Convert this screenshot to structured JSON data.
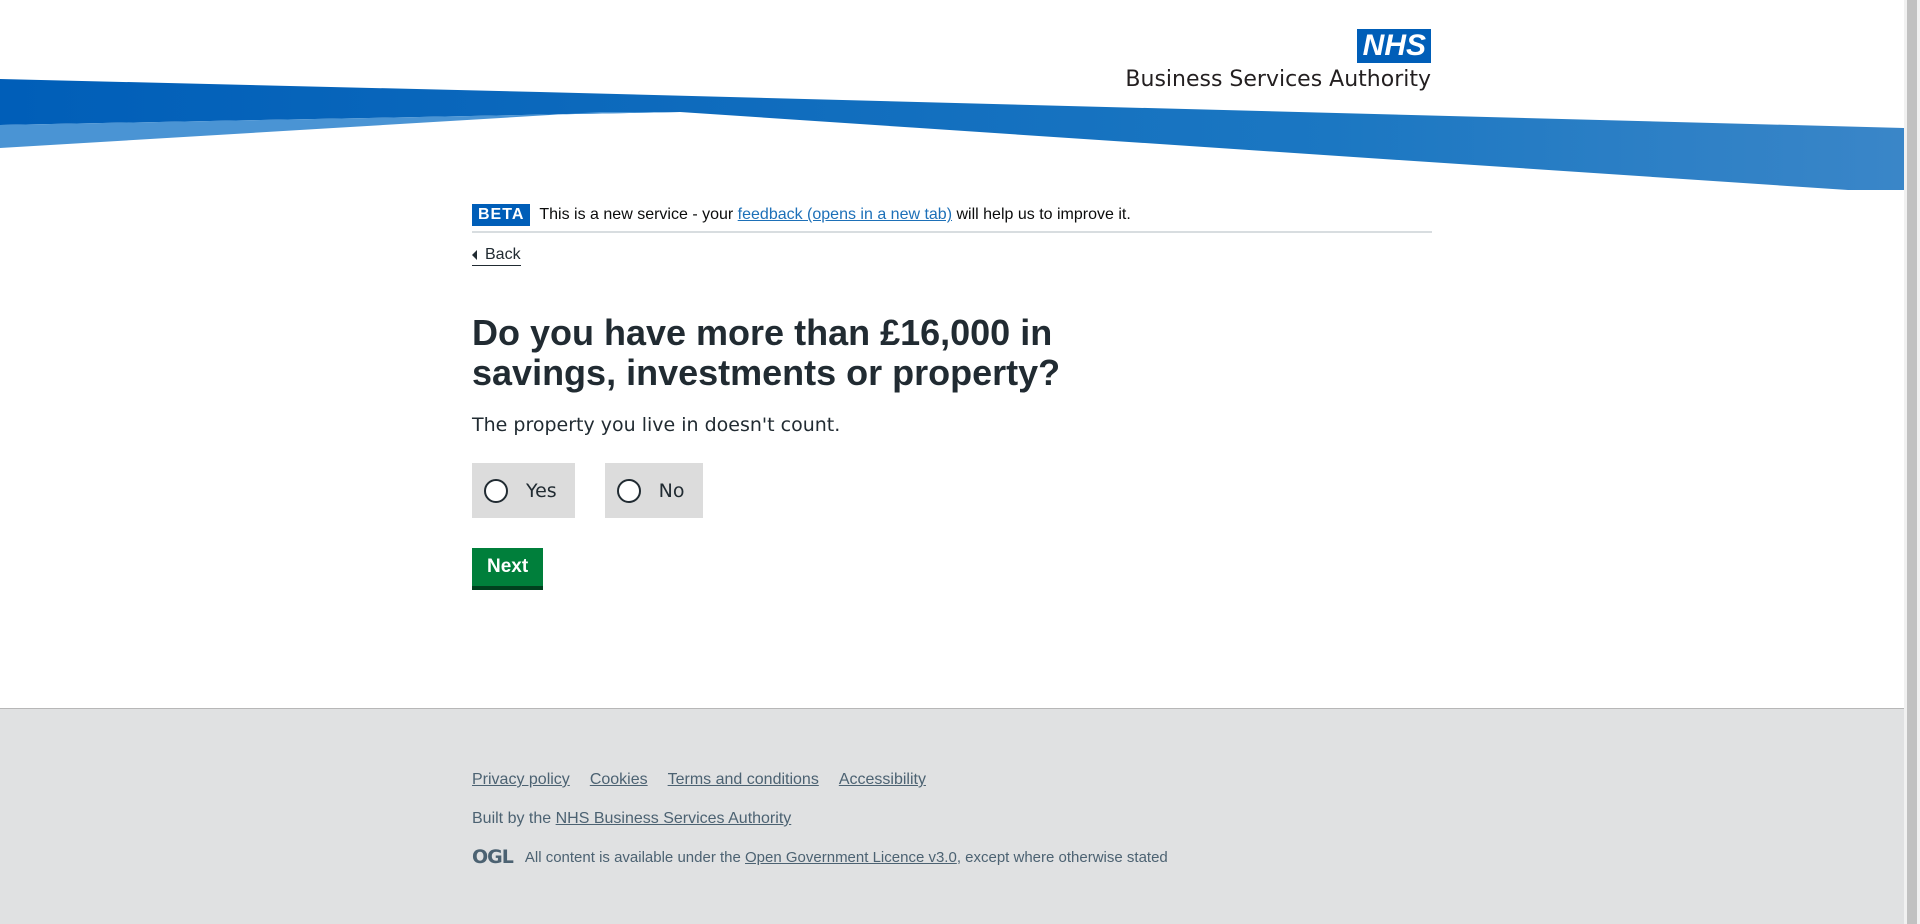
{
  "header": {
    "logo_text": "NHS",
    "org_name": "Business Services Authority",
    "colors": {
      "primary": "#005eb8",
      "wave_light": "#41b6e6"
    }
  },
  "phase_banner": {
    "tag": "BETA",
    "text_before": "This is a new service - your",
    "link_text": "feedback (opens in a new tab)",
    "text_after": "will help us to improve it."
  },
  "back_link": {
    "label": "Back",
    "icon": "chevron-left-icon"
  },
  "question": {
    "title": "Do you have more than £16,000 in savings, investments or property?",
    "hint": "The property you live in doesn't count."
  },
  "radios": [
    {
      "label": "Yes",
      "checked": false
    },
    {
      "label": "No",
      "checked": false
    }
  ],
  "next_button": {
    "label": "Next",
    "color": "#007f3b"
  },
  "footer": {
    "links": [
      "Privacy policy",
      "Cookies",
      "Terms and conditions",
      "Accessibility"
    ],
    "built_by_text": "Built by the",
    "built_by_link": "NHS Business Services Authority",
    "ogl_logo": "OGL",
    "licence_before": "All content is available under the",
    "licence_link": "Open Government Licence v3.0",
    "licence_after": ", except where otherwise stated"
  }
}
